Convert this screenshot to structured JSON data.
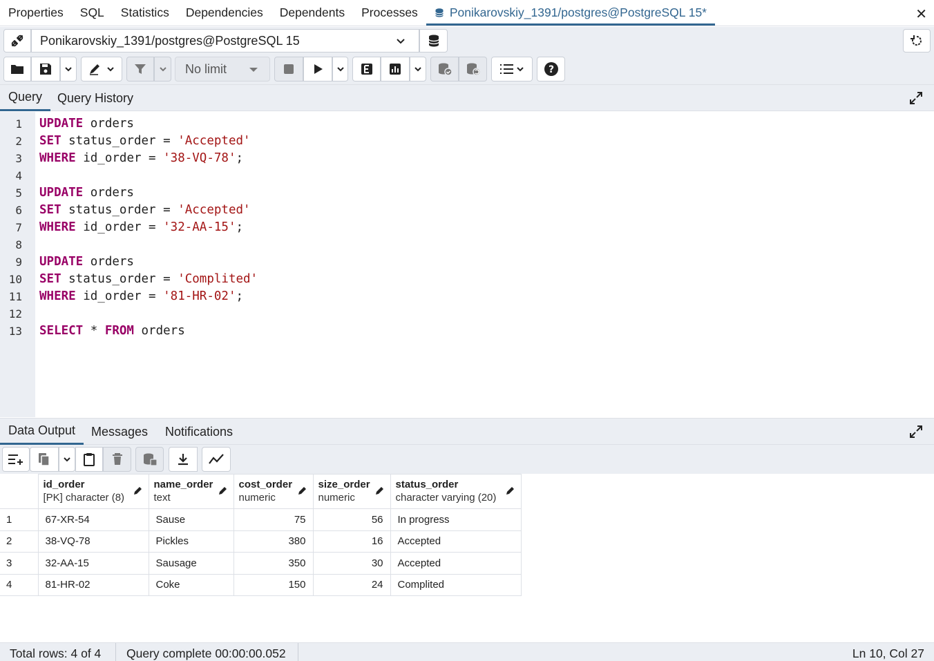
{
  "top_tabs": [
    "Properties",
    "SQL",
    "Statistics",
    "Dependencies",
    "Dependents",
    "Processes"
  ],
  "active_tab": "Ponikarovskiy_1391/postgres@PostgreSQL 15*",
  "connection": "Ponikarovskiy_1391/postgres@PostgreSQL 15",
  "toolbar": {
    "limit": "No limit"
  },
  "query_tabs": [
    "Query",
    "Query History"
  ],
  "editor_lines": [
    [
      {
        "t": "kw",
        "v": "UPDATE"
      },
      {
        "t": "pl",
        "v": " orders"
      }
    ],
    [
      {
        "t": "kw",
        "v": "SET"
      },
      {
        "t": "pl",
        "v": " status_order = "
      },
      {
        "t": "str",
        "v": "'Accepted'"
      }
    ],
    [
      {
        "t": "kw",
        "v": "WHERE"
      },
      {
        "t": "pl",
        "v": " id_order = "
      },
      {
        "t": "str",
        "v": "'38-VQ-78'"
      },
      {
        "t": "pl",
        "v": ";"
      }
    ],
    [],
    [
      {
        "t": "kw",
        "v": "UPDATE"
      },
      {
        "t": "pl",
        "v": " orders"
      }
    ],
    [
      {
        "t": "kw",
        "v": "SET"
      },
      {
        "t": "pl",
        "v": " status_order = "
      },
      {
        "t": "str",
        "v": "'Accepted'"
      }
    ],
    [
      {
        "t": "kw",
        "v": "WHERE"
      },
      {
        "t": "pl",
        "v": " id_order = "
      },
      {
        "t": "str",
        "v": "'32-AA-15'"
      },
      {
        "t": "pl",
        "v": ";"
      }
    ],
    [],
    [
      {
        "t": "kw",
        "v": "UPDATE"
      },
      {
        "t": "pl",
        "v": " orders"
      }
    ],
    [
      {
        "t": "kw",
        "v": "SET"
      },
      {
        "t": "pl",
        "v": " status_order = "
      },
      {
        "t": "str",
        "v": "'Complited'"
      }
    ],
    [
      {
        "t": "kw",
        "v": "WHERE"
      },
      {
        "t": "pl",
        "v": " id_order = "
      },
      {
        "t": "str",
        "v": "'81-HR-02'"
      },
      {
        "t": "pl",
        "v": ";"
      }
    ],
    [],
    [
      {
        "t": "kw",
        "v": "SELECT"
      },
      {
        "t": "pl",
        "v": " * "
      },
      {
        "t": "kw",
        "v": "FROM"
      },
      {
        "t": "pl",
        "v": " orders"
      }
    ]
  ],
  "output_tabs": [
    "Data Output",
    "Messages",
    "Notifications"
  ],
  "columns": [
    {
      "name": "id_order",
      "type": "[PK] character (8)"
    },
    {
      "name": "name_order",
      "type": "text"
    },
    {
      "name": "cost_order",
      "type": "numeric"
    },
    {
      "name": "size_order",
      "type": "numeric"
    },
    {
      "name": "status_order",
      "type": "character varying (20)"
    }
  ],
  "rows": [
    [
      "1",
      "67-XR-54",
      "Sause",
      "75",
      "56",
      "In progress"
    ],
    [
      "2",
      "38-VQ-78",
      "Pickles",
      "380",
      "16",
      "Accepted"
    ],
    [
      "3",
      "32-AA-15",
      "Sausage",
      "350",
      "30",
      "Accepted"
    ],
    [
      "4",
      "81-HR-02",
      "Coke",
      "150",
      "24",
      "Complited"
    ]
  ],
  "status": {
    "total_rows": "Total rows: 4 of 4",
    "query_complete": "Query complete 00:00:00.052",
    "cursor": "Ln 10, Col 27"
  },
  "colors": {
    "accent": "#326690",
    "keyword": "#990066",
    "string": "#a31515"
  }
}
